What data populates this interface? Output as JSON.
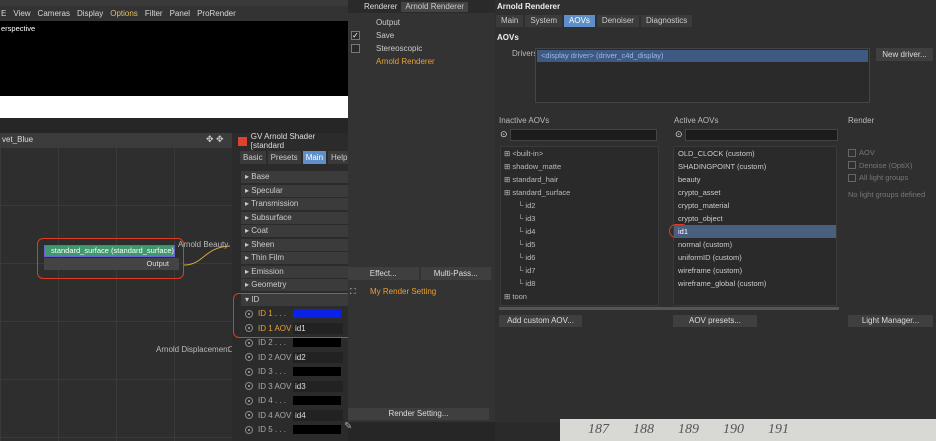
{
  "viewport": {
    "menu": [
      "E",
      "View",
      "Cameras",
      "Display",
      "Options",
      "Filter",
      "Panel",
      "ProRender"
    ],
    "label": "erspective"
  },
  "node_editor": {
    "title": "vet_Blue",
    "node_title": "standard_surface (standard_surface)",
    "node_output": "Output",
    "port_beauty": "Arnold Beauty",
    "port_displacement": "Arnold Displacement"
  },
  "attr": {
    "title": "GV Arnold Shader [standard",
    "tabs": [
      "Basic",
      "Presets",
      "Main",
      "Help"
    ],
    "sections": [
      "Base",
      "Specular",
      "Transmission",
      "Subsurface",
      "Coat",
      "Sheen",
      "Thin Film",
      "Emission",
      "Geometry"
    ],
    "id_section": "ID",
    "rows": [
      {
        "n": "ID 1 . . .",
        "t": "color",
        "c": "#0a22e8"
      },
      {
        "n": "ID 1 AOV",
        "t": "val",
        "v": "id1"
      },
      {
        "n": "ID 2 . . .",
        "t": "color",
        "c": "#000000"
      },
      {
        "n": "ID 2 AOV",
        "t": "val",
        "v": "id2"
      },
      {
        "n": "ID 3 . . .",
        "t": "color",
        "c": "#000000"
      },
      {
        "n": "ID 3 AOV",
        "t": "val",
        "v": "id3"
      },
      {
        "n": "ID 4 . . .",
        "t": "color",
        "c": "#000000"
      },
      {
        "n": "ID 4 AOV",
        "t": "val",
        "v": "id4"
      },
      {
        "n": "ID 5 . . .",
        "t": "color",
        "c": "#000000"
      }
    ]
  },
  "render_settings": {
    "renderer_label": "Renderer",
    "renderer_value": "Arnold Renderer",
    "items": [
      {
        "label": "Output",
        "checked": false,
        "orange": false
      },
      {
        "label": "Save",
        "checked": true,
        "orange": false
      },
      {
        "label": "Stereoscopic",
        "checked": false,
        "orange": false
      },
      {
        "label": "Arnold Renderer",
        "checked": false,
        "orange": true
      }
    ],
    "effect": "Effect...",
    "multipass": "Multi-Pass...",
    "my_setting": "My Render Setting",
    "render_setting": "Render Setting..."
  },
  "arnold": {
    "title": "Arnold Renderer",
    "tabs": [
      "Main",
      "System",
      "AOVs",
      "Denoiser",
      "Diagnostics"
    ],
    "aovs": "AOVs",
    "drivers": "Drivers",
    "driver_row": "<display driver> (driver_c4d_display)",
    "new_driver": "New driver...",
    "inactive_h": "Inactive AOVs",
    "active_h": "Active AOVs",
    "render_h": "Render",
    "inactive": [
      "<built-in>",
      "shadow_matte",
      "standard_hair",
      "standard_surface",
      "id2",
      "id3",
      "id4",
      "id5",
      "id6",
      "id7",
      "id8",
      "toon"
    ],
    "active": [
      "OLD_CLOCK (custom)",
      "SHADINGPOINT (custom)",
      "beauty",
      "crypto_asset",
      "crypto_material",
      "crypto_object",
      "id1",
      "normal (custom)",
      "uniformID (custom)",
      "wireframe (custom)",
      "wireframe_global (custom)"
    ],
    "render_opts": [
      "AOV",
      "Denoise (OptiX)",
      "All light groups"
    ],
    "no_lg": "No light groups defined",
    "btn_add": "Add custom AOV...",
    "btn_presets": "AOV presets...",
    "btn_light": "Light Manager..."
  },
  "ruler": [
    "187",
    "188",
    "189",
    "190",
    "191"
  ]
}
